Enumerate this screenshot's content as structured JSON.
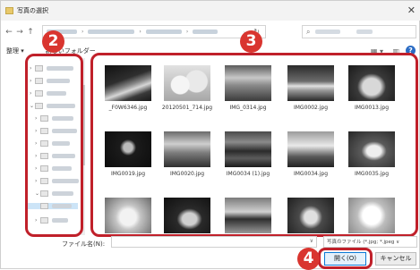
{
  "window": {
    "title": "写真の選択",
    "close_glyph": "✕"
  },
  "nav": {
    "back_glyph": "←",
    "forward_glyph": "→",
    "up_glyph": "↑",
    "addr_dropdown_glyph": "⌄",
    "refresh_glyph": "↻",
    "search_glyph": "⌕"
  },
  "toolbar": {
    "organize": "整理 ▾",
    "new_folder": "新しいフォルダー",
    "view_glyph": "▦ ▾",
    "pane_glyph": "▥",
    "help_glyph": "?"
  },
  "files": [
    {
      "name": "_F0W6346.jpg",
      "icon": "bird-photo"
    },
    {
      "name": "20120501_714.jpg",
      "icon": "cups-photo"
    },
    {
      "name": "IMG_0314.jpg",
      "icon": "meadow-photo"
    },
    {
      "name": "IMG0002.jpg",
      "icon": "beach-photo"
    },
    {
      "name": "IMG0013.jpg",
      "icon": "squirrel-photo"
    },
    {
      "name": "IMG0019.jpg",
      "icon": "dark-photo"
    },
    {
      "name": "IMG0020.jpg",
      "icon": "deer-photo"
    },
    {
      "name": "IMG0034 (1).jpg",
      "icon": "city-photo"
    },
    {
      "name": "IMG0034.jpg",
      "icon": "road-photo"
    },
    {
      "name": "IMG0035.jpg",
      "icon": "duck-photo"
    },
    {
      "name": "",
      "icon": "flower-photo"
    },
    {
      "name": "",
      "icon": "sheep-photo"
    },
    {
      "name": "",
      "icon": "car-photo"
    },
    {
      "name": "",
      "icon": "dog-photo"
    },
    {
      "name": "",
      "icon": "petals-photo"
    }
  ],
  "footer": {
    "filename_label": "ファイル名(N):",
    "filetype": "写真のファイル (*.jpg; *.jpeg ∨",
    "open_button": "開く(O)",
    "cancel_button": "キャンセル",
    "dropdown_glyph": "∨"
  },
  "callouts": {
    "left_pane": "2",
    "file_area": "3",
    "open_button": "4"
  },
  "colors": {
    "callout": "#d9352f",
    "highlight": "#c0202a",
    "open_button_border": "#0a79d6",
    "help_icon": "#2b6cc4"
  }
}
